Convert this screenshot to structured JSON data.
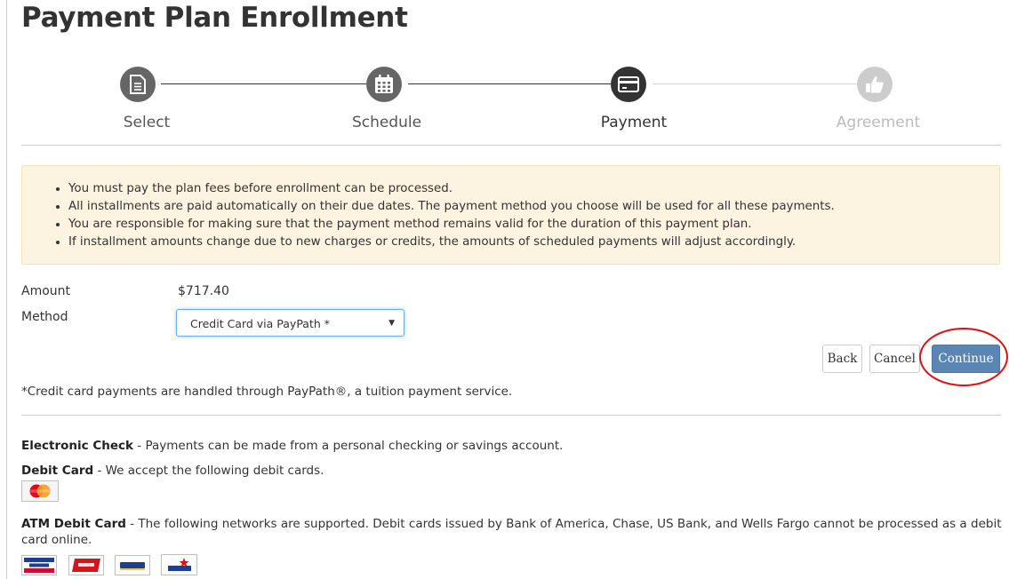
{
  "page": {
    "title": "Payment Plan Enrollment"
  },
  "stepper": {
    "steps": [
      {
        "label": "Select",
        "icon": "document-icon",
        "state": "done"
      },
      {
        "label": "Schedule",
        "icon": "calendar-icon",
        "state": "done"
      },
      {
        "label": "Payment",
        "icon": "credit-card-icon",
        "state": "current"
      },
      {
        "label": "Agreement",
        "icon": "thumbs-up-icon",
        "state": "upcoming"
      }
    ]
  },
  "notice": {
    "items": [
      "You must pay the plan fees before enrollment can be processed.",
      "All installments are paid automatically on their due dates. The payment method you choose will be used for all these payments.",
      "You are responsible for making sure that the payment method remains valid for the duration of this payment plan.",
      "If installment amounts change due to new charges or credits, the amounts of scheduled payments will adjust accordingly."
    ]
  },
  "form": {
    "amount_label": "Amount",
    "amount_value": "$717.40",
    "method_label": "Method",
    "method_value": "Credit Card via PayPath *"
  },
  "buttons": {
    "back": "Back",
    "cancel": "Cancel",
    "continue": "Continue"
  },
  "note": "*Credit card payments are handled through PayPath®, a tuition payment service.",
  "payment_info": {
    "echeck_title": "Electronic Check",
    "echeck_text": " - Payments can be made from a personal checking or savings  account.",
    "debit_title": "Debit Card",
    "debit_text": " - We accept the following debit cards.",
    "debit_cards": [
      "mastercard-logo"
    ],
    "atm_title": "ATM Debit Card",
    "atm_text_line1": " - The following networks are supported. Debit cards issued by Bank of America, Chase, US Bank, and Wells Fargo cannot be processed as a debit",
    "atm_text_line2": "card online.",
    "atm_networks": [
      "accel-logo",
      "nyce-logo",
      "pulse-logo",
      "star-logo"
    ]
  },
  "colors": {
    "primary_button": "#5b85b3",
    "notice_background": "#fcf4e0",
    "annotation_circle": "#e01010"
  }
}
